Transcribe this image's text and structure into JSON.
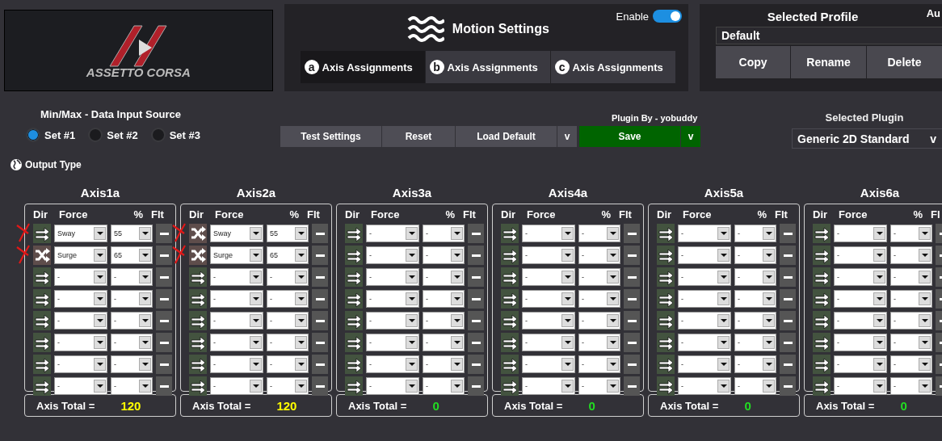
{
  "logo": {
    "text": "ASSETTO CORSA"
  },
  "motion": {
    "title": "Motion Settings",
    "enable": {
      "label": "Enable",
      "on": true
    },
    "tabs": [
      {
        "badge": "a",
        "label": "Axis Assignments",
        "selected": true
      },
      {
        "badge": "b",
        "label": "Axis Assignments",
        "selected": false
      },
      {
        "badge": "c",
        "label": "Axis Assignments",
        "selected": false
      }
    ]
  },
  "profile": {
    "title": "Selected Profile",
    "side_label": "Au",
    "value": "Default",
    "buttons": [
      "Copy",
      "Rename",
      "Delete"
    ]
  },
  "input_source": {
    "title": "Min/Max - Data Input Source",
    "options": [
      {
        "label": "Set #1",
        "selected": true
      },
      {
        "label": "Set #2",
        "selected": false
      },
      {
        "label": "Set #3",
        "selected": false
      }
    ]
  },
  "actions": {
    "plugin_by": "Plugin By - yobuddy",
    "buttons": [
      {
        "label": "Test Settings",
        "kind": "plain"
      },
      {
        "label": "Reset",
        "kind": "plain"
      },
      {
        "label": "Load Default",
        "kind": "plain"
      },
      {
        "label": "v",
        "kind": "caret"
      },
      {
        "label": "Save",
        "kind": "save"
      },
      {
        "label": "v",
        "kind": "save_caret"
      }
    ]
  },
  "plugin": {
    "title": "Selected Plugin",
    "value": "Generic 2D Standard",
    "caret": "v"
  },
  "output_type": {
    "label": "Output Type"
  },
  "axes": [
    {
      "title": "Axis1a",
      "columns": [
        "Dir",
        "Force",
        "%",
        "Flt"
      ],
      "total_label": "Axis Total =",
      "total": "120",
      "color": "#ffff00",
      "rows": [
        {
          "kind": "straight",
          "force": "Sway",
          "percent": "55",
          "marked": true
        },
        {
          "kind": "crossed",
          "force": "Surge",
          "percent": "65",
          "marked": true
        },
        {
          "kind": "straight",
          "force": "-",
          "percent": "-",
          "marked": false
        },
        {
          "kind": "straight",
          "force": "-",
          "percent": "-",
          "marked": false
        },
        {
          "kind": "straight",
          "force": "-",
          "percent": "-",
          "marked": false
        },
        {
          "kind": "straight",
          "force": "-",
          "percent": "-",
          "marked": false
        },
        {
          "kind": "straight",
          "force": "-",
          "percent": "-",
          "marked": false
        },
        {
          "kind": "straight",
          "force": "-",
          "percent": "-",
          "marked": false
        }
      ]
    },
    {
      "title": "Axis2a",
      "columns": [
        "Dir",
        "Force",
        "%",
        "Flt"
      ],
      "total_label": "Axis Total =",
      "total": "120",
      "color": "#ffff00",
      "rows": [
        {
          "kind": "crossed",
          "force": "Sway",
          "percent": "55",
          "marked": true
        },
        {
          "kind": "crossed",
          "force": "Surge",
          "percent": "65",
          "marked": true
        },
        {
          "kind": "straight",
          "force": "-",
          "percent": "-",
          "marked": false
        },
        {
          "kind": "straight",
          "force": "-",
          "percent": "-",
          "marked": false
        },
        {
          "kind": "straight",
          "force": "-",
          "percent": "-",
          "marked": false
        },
        {
          "kind": "straight",
          "force": "-",
          "percent": "-",
          "marked": false
        },
        {
          "kind": "straight",
          "force": "-",
          "percent": "-",
          "marked": false
        },
        {
          "kind": "straight",
          "force": "-",
          "percent": "-",
          "marked": false
        }
      ]
    },
    {
      "title": "Axis3a",
      "columns": [
        "Dir",
        "Force",
        "%",
        "Flt"
      ],
      "total_label": "Axis Total =",
      "total": "0",
      "color": "#22dd22",
      "rows": [
        {
          "kind": "straight",
          "force": "-",
          "percent": "-",
          "marked": false
        },
        {
          "kind": "straight",
          "force": "-",
          "percent": "-",
          "marked": false
        },
        {
          "kind": "straight",
          "force": "-",
          "percent": "-",
          "marked": false
        },
        {
          "kind": "straight",
          "force": "-",
          "percent": "-",
          "marked": false
        },
        {
          "kind": "straight",
          "force": "-",
          "percent": "-",
          "marked": false
        },
        {
          "kind": "straight",
          "force": "-",
          "percent": "-",
          "marked": false
        },
        {
          "kind": "straight",
          "force": "-",
          "percent": "-",
          "marked": false
        },
        {
          "kind": "straight",
          "force": "-",
          "percent": "-",
          "marked": false
        }
      ]
    },
    {
      "title": "Axis4a",
      "columns": [
        "Dir",
        "Force",
        "%",
        "Flt"
      ],
      "total_label": "Axis Total =",
      "total": "0",
      "color": "#22dd22",
      "rows": [
        {
          "kind": "straight",
          "force": "-",
          "percent": "-",
          "marked": false
        },
        {
          "kind": "straight",
          "force": "-",
          "percent": "-",
          "marked": false
        },
        {
          "kind": "straight",
          "force": "-",
          "percent": "-",
          "marked": false
        },
        {
          "kind": "straight",
          "force": "-",
          "percent": "-",
          "marked": false
        },
        {
          "kind": "straight",
          "force": "-",
          "percent": "-",
          "marked": false
        },
        {
          "kind": "straight",
          "force": "-",
          "percent": "-",
          "marked": false
        },
        {
          "kind": "straight",
          "force": "-",
          "percent": "-",
          "marked": false
        },
        {
          "kind": "straight",
          "force": "-",
          "percent": "-",
          "marked": false
        }
      ]
    },
    {
      "title": "Axis5a",
      "columns": [
        "Dir",
        "Force",
        "%",
        "Flt"
      ],
      "total_label": "Axis Total =",
      "total": "0",
      "color": "#22dd22",
      "rows": [
        {
          "kind": "straight",
          "force": "-",
          "percent": "-",
          "marked": false
        },
        {
          "kind": "straight",
          "force": "-",
          "percent": "-",
          "marked": false
        },
        {
          "kind": "straight",
          "force": "-",
          "percent": "-",
          "marked": false
        },
        {
          "kind": "straight",
          "force": "-",
          "percent": "-",
          "marked": false
        },
        {
          "kind": "straight",
          "force": "-",
          "percent": "-",
          "marked": false
        },
        {
          "kind": "straight",
          "force": "-",
          "percent": "-",
          "marked": false
        },
        {
          "kind": "straight",
          "force": "-",
          "percent": "-",
          "marked": false
        },
        {
          "kind": "straight",
          "force": "-",
          "percent": "-",
          "marked": false
        }
      ]
    },
    {
      "title": "Axis6a",
      "columns": [
        "Dir",
        "Force",
        "%",
        "Fl"
      ],
      "total_label": "Axis Total =",
      "total": "0",
      "color": "#22dd22",
      "rows": [
        {
          "kind": "straight",
          "force": "-",
          "percent": "-",
          "marked": false
        },
        {
          "kind": "straight",
          "force": "-",
          "percent": "-",
          "marked": false
        },
        {
          "kind": "straight",
          "force": "-",
          "percent": "-",
          "marked": false
        },
        {
          "kind": "straight",
          "force": "-",
          "percent": "-",
          "marked": false
        },
        {
          "kind": "straight",
          "force": "-",
          "percent": "-",
          "marked": false
        },
        {
          "kind": "straight",
          "force": "-",
          "percent": "-",
          "marked": false
        },
        {
          "kind": "straight",
          "force": "-",
          "percent": "-",
          "marked": false
        },
        {
          "kind": "straight",
          "force": "-",
          "percent": "-",
          "marked": false
        }
      ]
    }
  ]
}
